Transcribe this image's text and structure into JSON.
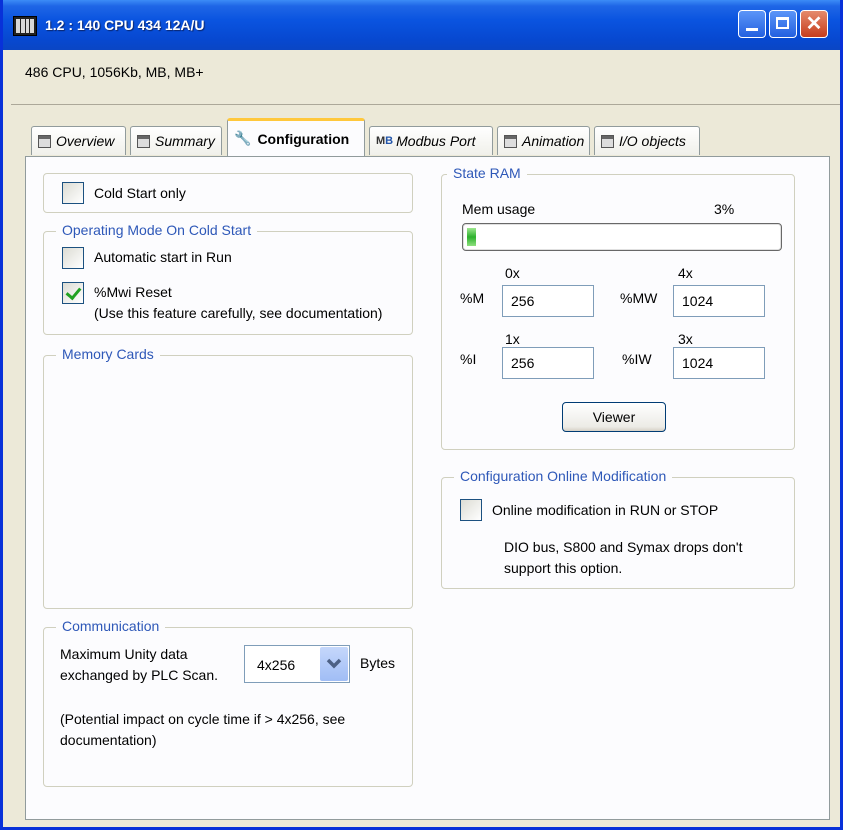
{
  "window": {
    "title": "1.2 : 140 CPU 434 12A/U"
  },
  "header": {
    "description": "486 CPU, 1056Kb, MB, MB+"
  },
  "tabs": [
    {
      "label": "Overview"
    },
    {
      "label": "Summary"
    },
    {
      "label": "Configuration"
    },
    {
      "label": "Modbus Port"
    },
    {
      "label": "Animation"
    },
    {
      "label": "I/O objects"
    }
  ],
  "cold_start": {
    "label": "Cold Start only",
    "checked": false
  },
  "operating_mode": {
    "title": "Operating Mode On Cold Start",
    "auto_start_label": "Automatic start in Run",
    "mwi_reset_label": "%Mwi Reset",
    "mwi_reset_note": "(Use this feature carefully, see documentation)",
    "mwi_reset_checked": true
  },
  "memory_cards": {
    "title": "Memory Cards"
  },
  "communication": {
    "title": "Communication",
    "max_label_line1": "Maximum Unity data",
    "max_label_line2": "exchanged by PLC Scan.",
    "select_value": "4x256",
    "unit": "Bytes",
    "note_line1": "(Potential impact on cycle time if > 4x256, see",
    "note_line2": "documentation)"
  },
  "state_ram": {
    "title": "State RAM",
    "mem_usage_label": "Mem usage",
    "mem_usage_percent": "3%",
    "m": {
      "label": "%M",
      "prefix": "0x",
      "value": "256"
    },
    "mw": {
      "label": "%MW",
      "prefix": "4x",
      "value": "1024"
    },
    "i": {
      "label": "%I",
      "prefix": "1x",
      "value": "256"
    },
    "iw": {
      "label": "%IW",
      "prefix": "3x",
      "value": "1024"
    },
    "viewer_button": "Viewer"
  },
  "online_mod": {
    "title": "Configuration Online Modification",
    "checkbox_label": "Online modification in RUN or STOP",
    "note_line1": "DIO bus, S800 and Symax drops don't",
    "note_line2": "support this option."
  }
}
